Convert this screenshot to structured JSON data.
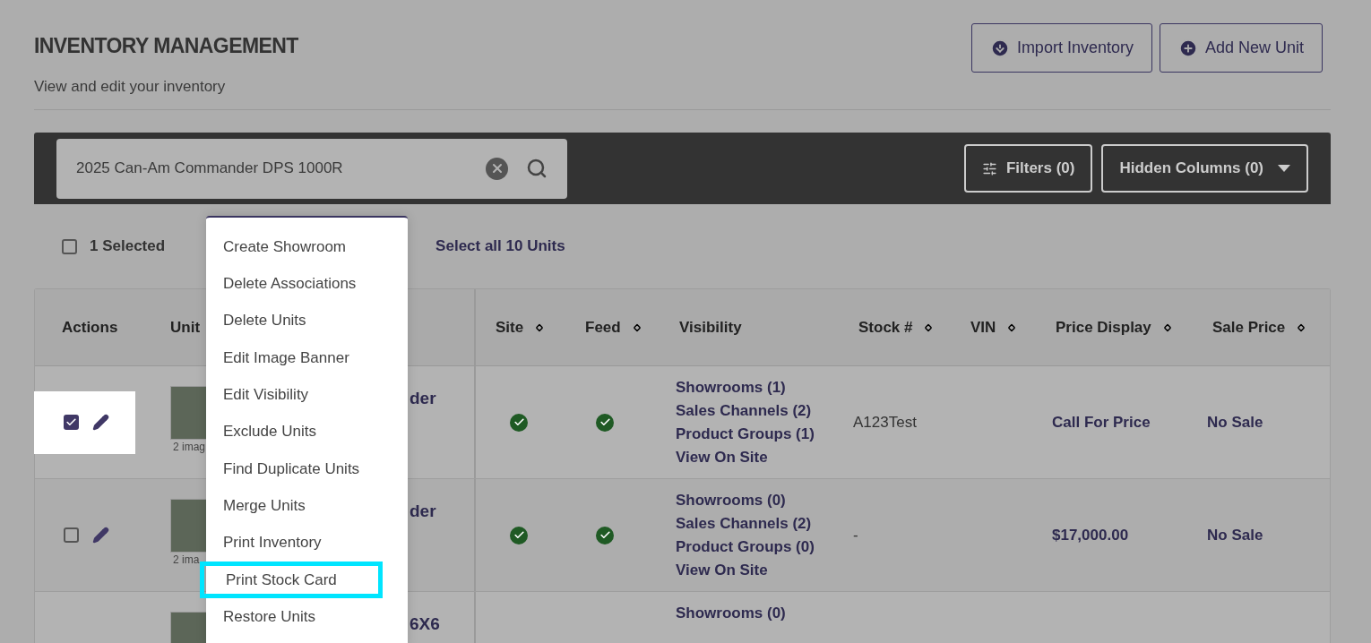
{
  "header": {
    "title": "INVENTORY MANAGEMENT",
    "subtitle": "View and edit your inventory",
    "buttons": [
      {
        "kind": "import",
        "label": "Import Inventory"
      },
      {
        "kind": "add",
        "label": "Add New Unit"
      }
    ]
  },
  "toolbar": {
    "search_value": "2025 Can-Am Commander DPS 1000R",
    "filters": "Filters (0)",
    "hidden_columns": "Hidden Columns (0)"
  },
  "selection": {
    "checked": false,
    "count_label": "1 Selected",
    "select_all": "Select all 10 Units"
  },
  "bulk_menu": [
    {
      "label": "Create Showroom",
      "selected": false
    },
    {
      "label": "Delete Associations",
      "selected": false
    },
    {
      "label": "Delete Units",
      "selected": false
    },
    {
      "label": "Edit Image Banner",
      "selected": false
    },
    {
      "label": "Edit Visibility",
      "selected": false
    },
    {
      "label": "Exclude Units",
      "selected": false
    },
    {
      "label": "Find Duplicate Units",
      "selected": false
    },
    {
      "label": "Merge Units",
      "selected": false
    },
    {
      "label": "Print Inventory",
      "selected": false
    },
    {
      "label": "Print Stock Card",
      "selected": true
    },
    {
      "label": "Restore Units",
      "selected": false
    }
  ],
  "table": {
    "columns": [
      {
        "label": "Actions",
        "sortable": false
      },
      {
        "label": "Unit",
        "sortable": false
      },
      {
        "label": "Site",
        "sortable": true
      },
      {
        "label": "Feed",
        "sortable": true
      },
      {
        "label": "Visibility",
        "sortable": false
      },
      {
        "label": "Stock #",
        "sortable": true
      },
      {
        "label": "VIN",
        "sortable": true
      },
      {
        "label": "Price Display",
        "sortable": true
      },
      {
        "label": "Sale Price",
        "sortable": true
      }
    ],
    "rows": [
      {
        "checked": true,
        "image_caption": "2 imag",
        "name": "der",
        "site": true,
        "feed": true,
        "visibility": [
          "Showrooms (1)",
          "Sales Channels (2)",
          "Product Groups (1)",
          "View On Site"
        ],
        "stock": "A123Test",
        "price": "Call For Price",
        "sale": "No Sale"
      },
      {
        "checked": false,
        "image_caption": "2 ima",
        "name": "der",
        "site": true,
        "feed": true,
        "visibility": [
          "Showrooms (0)",
          "Sales Channels (2)",
          "Product Groups (0)",
          "View On Site"
        ],
        "stock": "-",
        "price": "$17,000.00",
        "sale": "No Sale"
      },
      {
        "name": "6X6",
        "visibility": [
          "Showrooms (0)"
        ]
      }
    ]
  }
}
